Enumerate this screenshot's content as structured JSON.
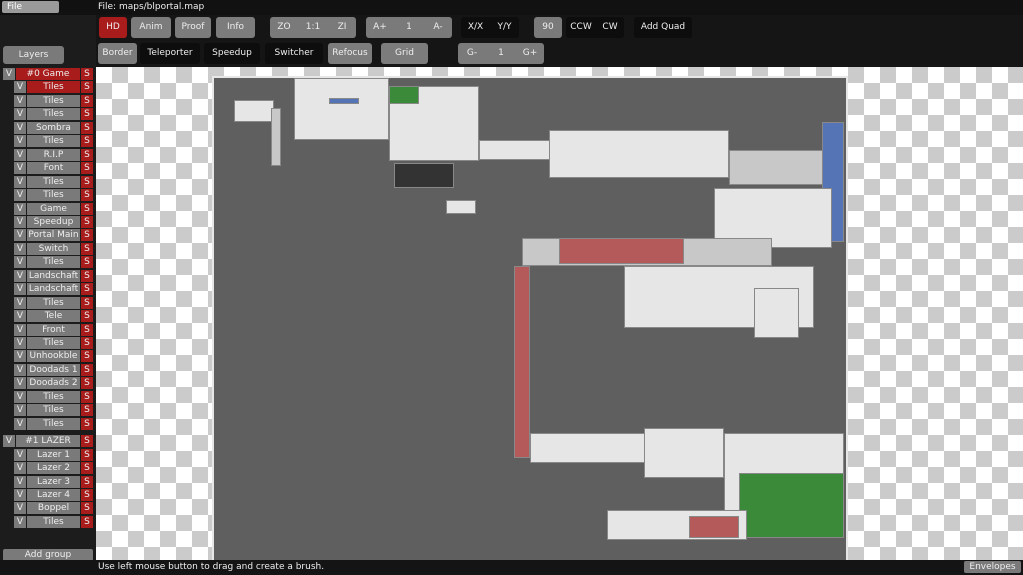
{
  "menu": {
    "file": "File",
    "file_label": "File: maps/blportal.map"
  },
  "toolbar": {
    "hd": "HD",
    "anim": "Anim",
    "proof": "Proof",
    "info": "Info",
    "zo": "ZO",
    "one_one": "1:1",
    "zi": "ZI",
    "a_plus": "A+",
    "a_val": "1",
    "a_minus": "A-",
    "xx": "X/X",
    "yy": "Y/Y",
    "rot": "90",
    "ccw": "CCW",
    "cw": "CW",
    "add_quad": "Add Quad",
    "border": "Border",
    "teleporter": "Teleporter",
    "speedup": "Speedup",
    "switcher": "Switcher",
    "refocus": "Refocus",
    "grid": "Grid",
    "g_minus": "G-",
    "g_val": "1",
    "g_plus": "G+"
  },
  "sidebar": {
    "layers_tab": "Layers",
    "add_group": "Add group",
    "v": "V",
    "s": "S",
    "groups": [
      {
        "name": "#0 Game",
        "layers": [
          "Tiles",
          "Tiles",
          "Tiles",
          "Sombra",
          "Tiles",
          "R.I.P",
          "Font",
          "Tiles",
          "Tiles",
          "Game",
          "Speedup",
          "Portal Main",
          "Switch",
          "Tiles",
          "Landschaft",
          "Landschaft",
          "Tiles",
          "Tele",
          "Front",
          "Tiles",
          "Unhookble",
          "Doodads 1",
          "Doodads 2",
          "Tiles",
          "Tiles",
          "Tiles"
        ]
      },
      {
        "name": "#1 LAZER",
        "layers": [
          "Lazer 1",
          "Lazer 2",
          "Lazer 3",
          "Lazer 4",
          "Boppel",
          "Tiles"
        ]
      }
    ]
  },
  "status": {
    "hint": "Use left mouse button to drag and create a brush.",
    "envelopes": "Envelopes"
  }
}
